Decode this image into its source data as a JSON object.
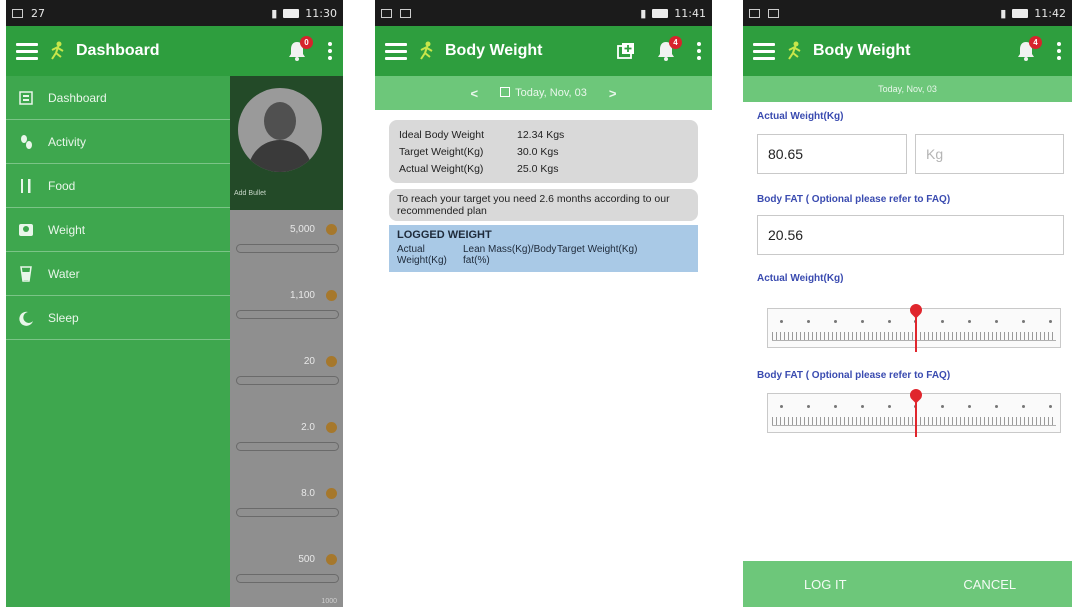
{
  "status1": {
    "left": "27",
    "time": "11:30"
  },
  "status2": {
    "left": "",
    "time": "11:41"
  },
  "status3": {
    "left": "",
    "time": "11:42"
  },
  "phone1": {
    "title": "Dashboard",
    "badge": "0",
    "drawer_items": [
      {
        "label": "Dashboard",
        "icon": "dashboard-icon"
      },
      {
        "label": "Activity",
        "icon": "footprint-icon"
      },
      {
        "label": "Food",
        "icon": "fork-knife-icon"
      },
      {
        "label": "Weight",
        "icon": "scale-icon"
      },
      {
        "label": "Water",
        "icon": "glass-icon"
      },
      {
        "label": "Sleep",
        "icon": "moon-icon"
      }
    ],
    "behind": {
      "add_bullet": "Add Bullet",
      "values": [
        "5,000",
        "1,100",
        "20",
        "2.0",
        "8.0",
        "500"
      ],
      "footer": "1000"
    }
  },
  "phone2": {
    "title": "Body Weight",
    "badge": "4",
    "date": "Today, Nov, 03",
    "stats": [
      {
        "k": "Ideal Body Weight",
        "v": "12.34 Kgs"
      },
      {
        "k": "Target Weight(Kg)",
        "v": "30.0 Kgs"
      },
      {
        "k": "Actual Weight(Kg)",
        "v": "25.0 Kgs"
      }
    ],
    "message": "To reach your target you need 2.6 months according to our recommended plan",
    "logged": {
      "title": "LOGGED WEIGHT",
      "col1": "Actual Weight(Kg)",
      "col2": "Lean Mass(Kg)/Body fat(%)",
      "col3": "Target Weight(Kg)"
    }
  },
  "phone3": {
    "title": "Body Weight",
    "badge": "4",
    "date": "Today, Nov, 03",
    "actual_label": "Actual Weight(Kg)",
    "actual_value": "80.65",
    "unit_placeholder": "Kg",
    "fat_label": "Body FAT ( Optional please refer to FAQ)",
    "fat_value": "20.56",
    "ruler1_label": "Actual Weight(Kg)",
    "ruler2_label": "Body FAT ( Optional please refer to FAQ)",
    "log_button": "LOG IT",
    "cancel_button": "CANCEL"
  },
  "colors": {
    "primary": "#2e9e3e",
    "light": "#6dc77a",
    "drawer": "#3ea74e",
    "badge": "#d7232c",
    "label": "#3a4bb0"
  }
}
